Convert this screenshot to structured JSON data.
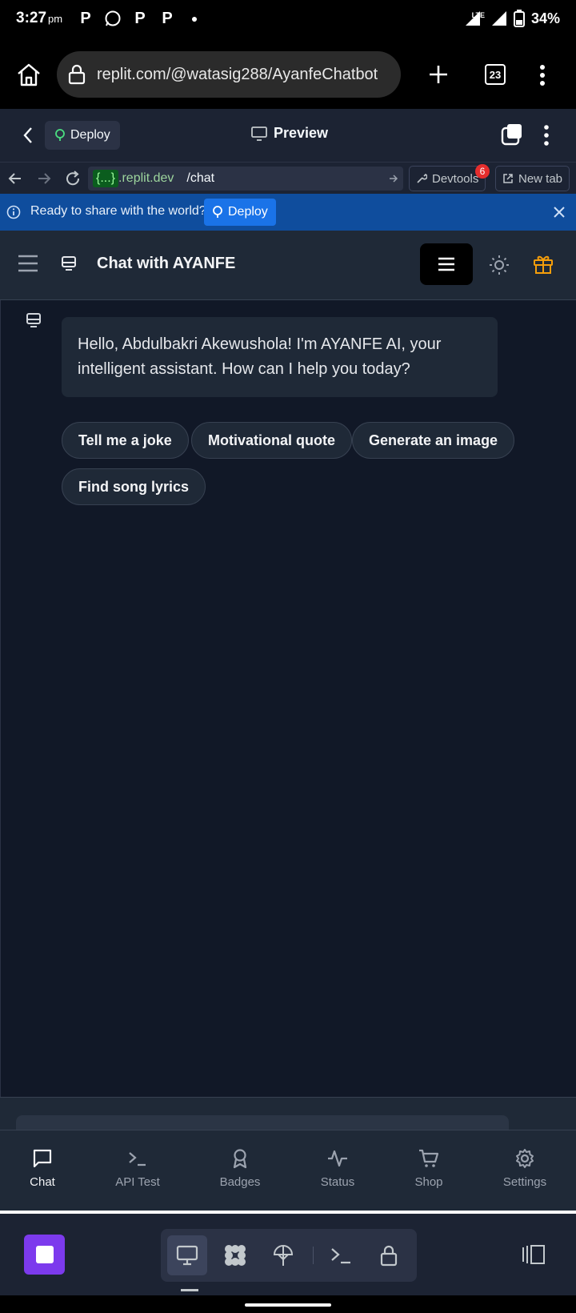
{
  "status_bar": {
    "time": "3:27",
    "ampm": "pm",
    "network": "LTE",
    "battery": "34%"
  },
  "browser": {
    "url": "replit.com/@watasig288/AyanfeChatbot",
    "tab_count": "23"
  },
  "replit_header": {
    "deploy_label": "Deploy",
    "preview_label": "Preview"
  },
  "address_bar": {
    "host_braces": "{...}",
    "host_domain": ".replit.dev",
    "path": "/chat",
    "devtools_label": "Devtools",
    "devtools_badge": "6",
    "new_tab_label": "New tab"
  },
  "banner": {
    "text": "Ready to share with the world?",
    "deploy_label": "Deploy"
  },
  "app": {
    "title": "Chat with AYANFE",
    "welcome_line1": "Hello, Abdulbakri Akewushola! I'm AYANFE AI, your",
    "welcome_line2": "intelligent assistant. How can I help you today?",
    "suggestions": [
      "Tell me a joke",
      "Motivational quote",
      "Generate an image",
      "Find song lyrics"
    ]
  },
  "nav": {
    "items": [
      {
        "label": "Chat",
        "icon": "chat-icon",
        "active": true
      },
      {
        "label": "API Test",
        "icon": "terminal-icon",
        "active": false
      },
      {
        "label": "Badges",
        "icon": "badge-icon",
        "active": false
      },
      {
        "label": "Status",
        "icon": "activity-icon",
        "active": false
      },
      {
        "label": "Shop",
        "icon": "cart-icon",
        "active": false
      },
      {
        "label": "Settings",
        "icon": "gear-icon",
        "active": false
      }
    ]
  },
  "colors": {
    "chat_bg": "#111827",
    "surface": "#1f2937",
    "banner": "#0f4d9d",
    "gift_accent": "#f59e0b",
    "run_button": "#7c3aed"
  }
}
